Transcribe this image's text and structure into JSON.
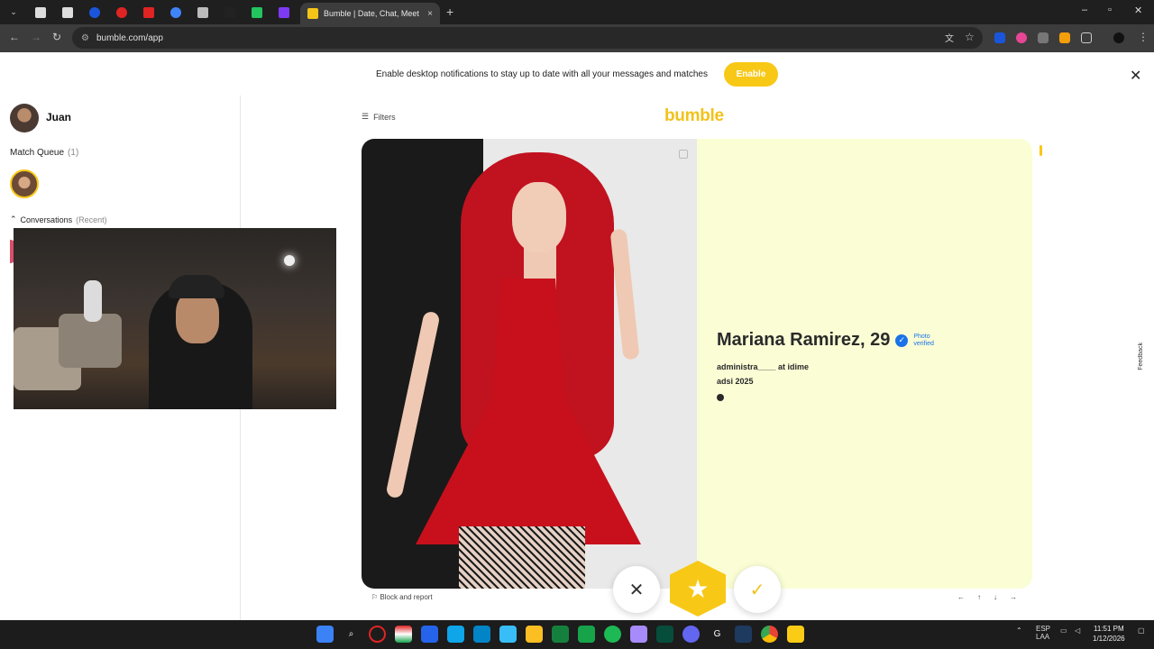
{
  "browser": {
    "active_tab_title": "Bumble | Date, Chat, Meet New",
    "url": "bumble.com/app",
    "new_tab_icon": "+",
    "tab_close_icon": "×",
    "window_controls": [
      "–",
      "▫",
      "✕"
    ]
  },
  "notification": {
    "text": "Enable desktop notifications to stay up to date with all your messages and matches",
    "button_label": "Enable",
    "close_icon": "✕"
  },
  "sidebar": {
    "user_name": "Juan",
    "match_queue_label": "Match Queue",
    "match_queue_count": "(1)",
    "conversations_label": "Conversations",
    "conversations_sub": "(Recent)"
  },
  "main": {
    "filters_label": "Filters",
    "logo": "bumble",
    "profile": {
      "name": "Mariana Ramirez, 29",
      "verified_label": "Photo verified",
      "job": "administra____ at idime",
      "education": "adsi 2025"
    },
    "block_report_label": "⚐ Block and report",
    "keyboard_hints": [
      "←",
      "↑",
      "↓",
      "→"
    ],
    "feedback_label": "Feedback"
  },
  "actions": {
    "pass_icon": "✕",
    "superswipe_icon": "★",
    "like_icon": "✓"
  },
  "taskbar": {
    "language": "ESP",
    "layout": "LAA",
    "time": "11:51 PM",
    "date": "1/12/2026"
  },
  "colors": {
    "brand_yellow": "#f8c817",
    "card_bg": "#fbfdd5",
    "verified_blue": "#1a73e8"
  }
}
